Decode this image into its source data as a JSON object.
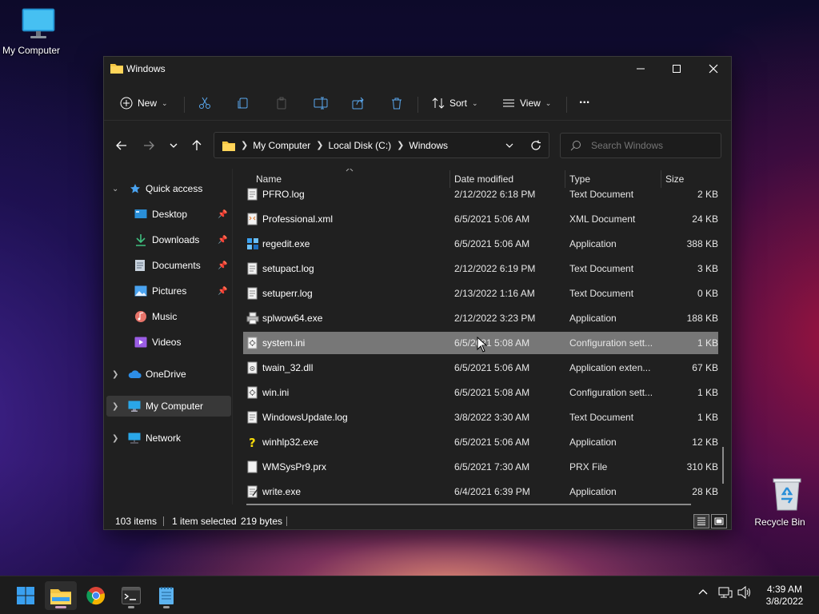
{
  "desktop": {
    "my_computer_label": "My Computer",
    "recycle_bin_label": "Recycle Bin"
  },
  "window": {
    "title": "Windows",
    "toolbar": {
      "new_label": "New",
      "sort_label": "Sort",
      "view_label": "View",
      "more_label": "..."
    },
    "breadcrumb": [
      "My Computer",
      "Local Disk (C:)",
      "Windows"
    ],
    "search_placeholder": "Search Windows",
    "sidebar": {
      "quick_access": "Quick access",
      "items": [
        {
          "label": "Desktop",
          "pinned": true
        },
        {
          "label": "Downloads",
          "pinned": true
        },
        {
          "label": "Documents",
          "pinned": true
        },
        {
          "label": "Pictures",
          "pinned": true
        },
        {
          "label": "Music",
          "pinned": false
        },
        {
          "label": "Videos",
          "pinned": false
        }
      ],
      "onedrive": "OneDrive",
      "my_computer": "My Computer",
      "network": "Network"
    },
    "columns": {
      "name": "Name",
      "date": "Date modified",
      "type": "Type",
      "size": "Size"
    },
    "files": [
      {
        "name": "PFRO.log",
        "date": "2/12/2022 6:18 PM",
        "type": "Text Document",
        "size": "2 KB",
        "icon": "text-file-icon"
      },
      {
        "name": "Professional.xml",
        "date": "6/5/2021 5:06 AM",
        "type": "XML Document",
        "size": "24 KB",
        "icon": "xml-file-icon"
      },
      {
        "name": "regedit.exe",
        "date": "6/5/2021 5:06 AM",
        "type": "Application",
        "size": "388 KB",
        "icon": "regedit-icon"
      },
      {
        "name": "setupact.log",
        "date": "2/12/2022 6:19 PM",
        "type": "Text Document",
        "size": "3 KB",
        "icon": "text-file-icon"
      },
      {
        "name": "setuperr.log",
        "date": "2/13/2022 1:16 AM",
        "type": "Text Document",
        "size": "0 KB",
        "icon": "text-file-icon"
      },
      {
        "name": "splwow64.exe",
        "date": "2/12/2022 3:23 PM",
        "type": "Application",
        "size": "188 KB",
        "icon": "printer-icon"
      },
      {
        "name": "system.ini",
        "date": "6/5/2021 5:08 AM",
        "type": "Configuration sett...",
        "size": "1 KB",
        "icon": "config-file-icon",
        "selected": true
      },
      {
        "name": "twain_32.dll",
        "date": "6/5/2021 5:06 AM",
        "type": "Application exten...",
        "size": "67 KB",
        "icon": "dll-file-icon"
      },
      {
        "name": "win.ini",
        "date": "6/5/2021 5:08 AM",
        "type": "Configuration sett...",
        "size": "1 KB",
        "icon": "config-file-icon"
      },
      {
        "name": "WindowsUpdate.log",
        "date": "3/8/2022 3:30 AM",
        "type": "Text Document",
        "size": "1 KB",
        "icon": "text-file-icon"
      },
      {
        "name": "winhlp32.exe",
        "date": "6/5/2021 5:06 AM",
        "type": "Application",
        "size": "12 KB",
        "icon": "help-icon"
      },
      {
        "name": "WMSysPr9.prx",
        "date": "6/5/2021 7:30 AM",
        "type": "PRX File",
        "size": "310 KB",
        "icon": "blank-file-icon"
      },
      {
        "name": "write.exe",
        "date": "6/4/2021 6:39 PM",
        "type": "Application",
        "size": "28 KB",
        "icon": "write-icon"
      }
    ],
    "status": {
      "items": "103 items",
      "selected": "1 item selected",
      "bytes": "219 bytes"
    }
  },
  "taskbar": {
    "apps": [
      "start-icon",
      "file-explorer-icon",
      "chrome-icon",
      "terminal-icon",
      "notepad-icon"
    ],
    "time": "4:39 AM",
    "date": "3/8/2022"
  },
  "colors": {
    "window_bg": "#202020",
    "selected_row": "#777777",
    "folder_yellow": "#f4c542",
    "accent_blue": "#4aa3f0"
  }
}
